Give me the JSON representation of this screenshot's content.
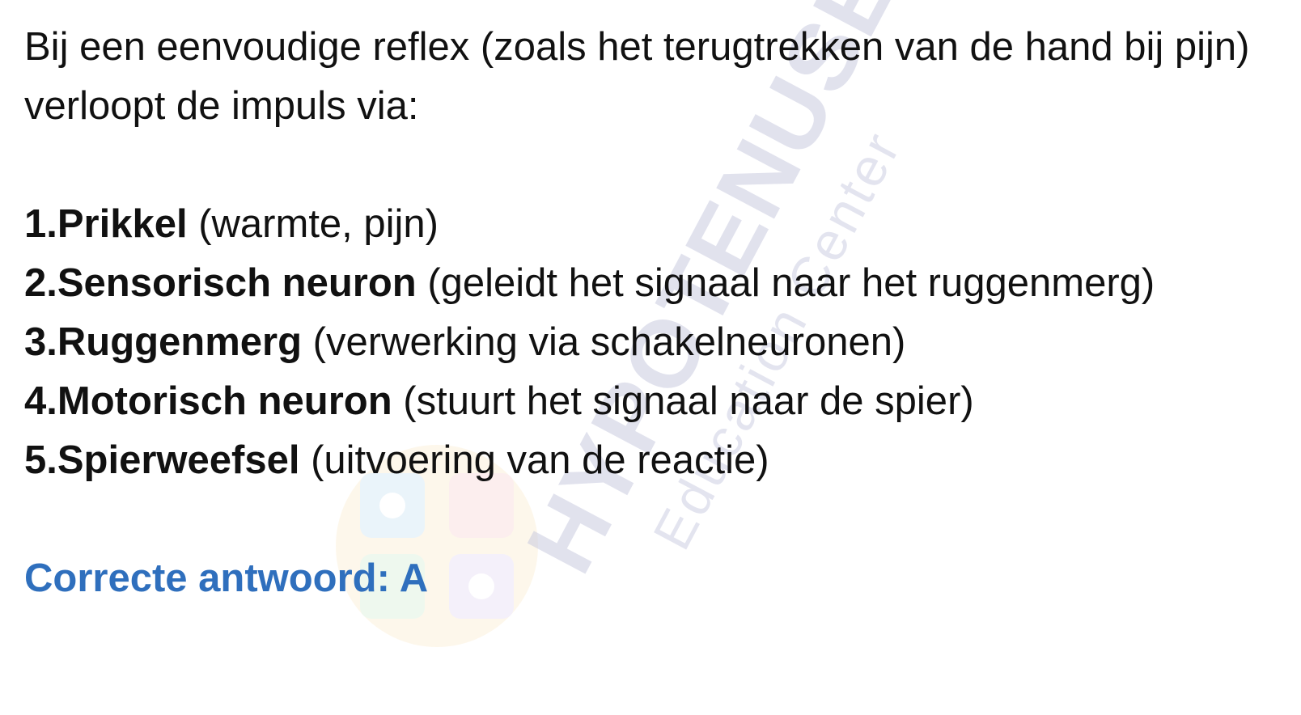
{
  "intro": "Bij een eenvoudige reflex (zoals het terugtrekken van de hand bij pijn) verloopt de impuls via:",
  "steps": [
    {
      "number": "1.",
      "title": "Prikkel",
      "detail": " (warmte, pijn)"
    },
    {
      "number": "2.",
      "title": "Sensorisch neuron",
      "detail": " (geleidt het signaal naar het ruggenmerg)"
    },
    {
      "number": "3.",
      "title": "Ruggenmerg",
      "detail": " (verwerking via schakelneuronen)"
    },
    {
      "number": "4.",
      "title": "Motorisch neuron",
      "detail": " (stuurt het signaal naar de spier)"
    },
    {
      "number": "5.",
      "title": "Spierweefsel",
      "detail": " (uitvoering van de reactie)"
    }
  ],
  "answer": "Correcte antwoord: A",
  "watermark": {
    "brand": "HYPOTENUSE",
    "sub": "Education Center"
  },
  "colors": {
    "text": "#111111",
    "answer": "#2f6fbd",
    "watermark": "#c9cbe0"
  }
}
